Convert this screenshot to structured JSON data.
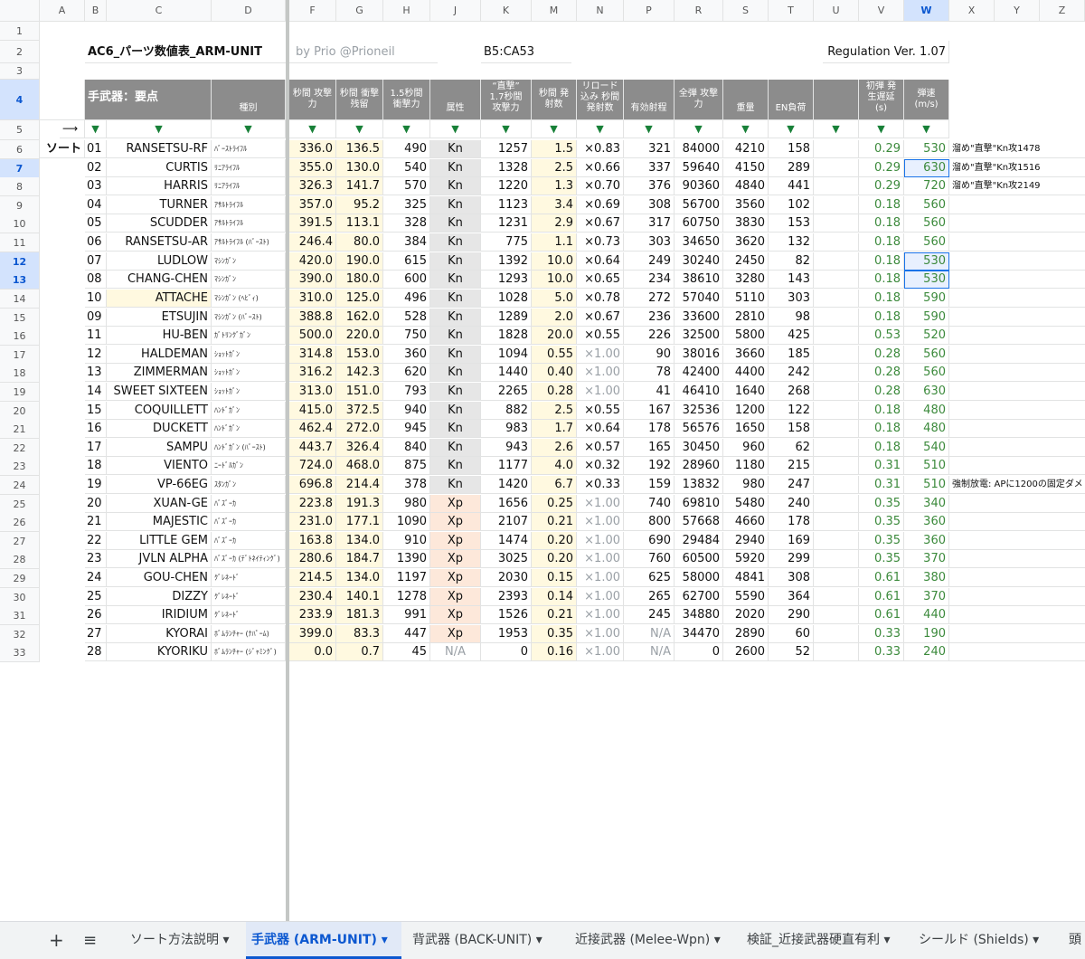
{
  "column_letters": [
    "A",
    "B",
    "C",
    "D",
    "F",
    "G",
    "H",
    "J",
    "K",
    "M",
    "N",
    "P",
    "R",
    "S",
    "T",
    "U",
    "V",
    "W",
    "X",
    "Y",
    "Z"
  ],
  "row2": {
    "title": "AC6_パーツ数値表_ARM-UNIT",
    "byline": "by Prio @Prioneil",
    "range": "B5:CA53",
    "regulation": "Regulation Ver. 1.07"
  },
  "row4": {
    "label": "手武器：要点",
    "type": "種別",
    "h_f": "秒間 攻撃力",
    "h_g": "秒間 衝撃残留",
    "h_h": "1.5秒間 衝撃力",
    "h_j": "属性",
    "h_k": "“直撃” 1.7秒間 攻撃力",
    "h_m": "秒間 発射数",
    "h_n": "リロード込み 秒間 発射数",
    "h_p": "有効射程",
    "h_r": "全弾 攻撃力",
    "h_s": "重量",
    "h_t": "EN負荷",
    "h_v": "初弾 発生遅延 (s)",
    "h_w": "弾速 (m/s)"
  },
  "row5": {
    "arrow": "⟶",
    "sort": "ソート"
  },
  "rows": [
    [
      "6",
      "01",
      "RANSETSU-RF",
      "ﾊﾞｰｽﾄﾗｲﾌﾙ",
      "336.0",
      "136.5",
      "490",
      "Kn",
      "1257",
      "1.5",
      "×0.83",
      "321",
      "84000",
      "4210",
      "158",
      "0.29",
      "530",
      "溜め\"直撃\"Kn攻1478"
    ],
    [
      "7",
      "02",
      "CURTIS",
      "ﾘﾆｱﾗｲﾌﾙ",
      "355.0",
      "130.0",
      "540",
      "Kn",
      "1328",
      "2.5",
      "×0.66",
      "337",
      "59640",
      "4150",
      "289",
      "0.29",
      "630",
      "溜め\"直撃\"Kn攻1516"
    ],
    [
      "8",
      "03",
      "HARRIS",
      "ﾘﾆｱﾗｲﾌﾙ",
      "326.3",
      "141.7",
      "570",
      "Kn",
      "1220",
      "1.3",
      "×0.70",
      "376",
      "90360",
      "4840",
      "441",
      "0.29",
      "720",
      "溜め\"直撃\"Kn攻2149"
    ],
    [
      "9",
      "04",
      "TURNER",
      "ｱｻﾙﾄﾗｲﾌﾙ",
      "357.0",
      "95.2",
      "325",
      "Kn",
      "1123",
      "3.4",
      "×0.69",
      "308",
      "56700",
      "3560",
      "102",
      "0.18",
      "560",
      ""
    ],
    [
      "10",
      "05",
      "SCUDDER",
      "ｱｻﾙﾄﾗｲﾌﾙ",
      "391.5",
      "113.1",
      "328",
      "Kn",
      "1231",
      "2.9",
      "×0.67",
      "317",
      "60750",
      "3830",
      "153",
      "0.18",
      "560",
      ""
    ],
    [
      "11",
      "06",
      "RANSETSU-AR",
      "ｱｻﾙﾄﾗｲﾌﾙ (ﾊﾞｰｽﾄ)",
      "246.4",
      "80.0",
      "384",
      "Kn",
      "775",
      "1.1",
      "×0.73",
      "303",
      "34650",
      "3620",
      "132",
      "0.18",
      "560",
      ""
    ],
    [
      "12",
      "07",
      "LUDLOW",
      "ﾏｼﾝｶﾞﾝ",
      "420.0",
      "190.0",
      "615",
      "Kn",
      "1392",
      "10.0",
      "×0.64",
      "249",
      "30240",
      "2450",
      "82",
      "0.18",
      "530",
      ""
    ],
    [
      "13",
      "08",
      "CHANG-CHEN",
      "ﾏｼﾝｶﾞﾝ",
      "390.0",
      "180.0",
      "600",
      "Kn",
      "1293",
      "10.0",
      "×0.65",
      "234",
      "38610",
      "3280",
      "143",
      "0.18",
      "530",
      ""
    ],
    [
      "14",
      "10",
      "ATTACHE",
      "ﾏｼﾝｶﾞﾝ (ﾍﾋﾞｨ)",
      "310.0",
      "125.0",
      "496",
      "Kn",
      "1028",
      "5.0",
      "×0.78",
      "272",
      "57040",
      "5110",
      "303",
      "0.18",
      "590",
      ""
    ],
    [
      "15",
      "09",
      "ETSUJIN",
      "ﾏｼﾝｶﾞﾝ (ﾊﾞｰｽﾄ)",
      "388.8",
      "162.0",
      "528",
      "Kn",
      "1289",
      "2.0",
      "×0.67",
      "236",
      "33600",
      "2810",
      "98",
      "0.18",
      "590",
      ""
    ],
    [
      "16",
      "11",
      "HU-BEN",
      "ｶﾞﾄﾘﾝｸﾞｶﾞﾝ",
      "500.0",
      "220.0",
      "750",
      "Kn",
      "1828",
      "20.0",
      "×0.55",
      "226",
      "32500",
      "5800",
      "425",
      "0.53",
      "520",
      ""
    ],
    [
      "17",
      "12",
      "HALDEMAN",
      "ｼｮｯﾄｶﾞﾝ",
      "314.8",
      "153.0",
      "360",
      "Kn",
      "1094",
      "0.55",
      "×1.00",
      "90",
      "38016",
      "3660",
      "185",
      "0.28",
      "560",
      ""
    ],
    [
      "18",
      "13",
      "ZIMMERMAN",
      "ｼｮｯﾄｶﾞﾝ",
      "316.2",
      "142.3",
      "620",
      "Kn",
      "1440",
      "0.40",
      "×1.00",
      "78",
      "42400",
      "4400",
      "242",
      "0.28",
      "560",
      ""
    ],
    [
      "19",
      "14",
      "SWEET SIXTEEN",
      "ｼｮｯﾄｶﾞﾝ",
      "313.0",
      "151.0",
      "793",
      "Kn",
      "2265",
      "0.28",
      "×1.00",
      "41",
      "46410",
      "1640",
      "268",
      "0.28",
      "630",
      ""
    ],
    [
      "20",
      "15",
      "COQUILLETT",
      "ﾊﾝﾄﾞｶﾞﾝ",
      "415.0",
      "372.5",
      "940",
      "Kn",
      "882",
      "2.5",
      "×0.55",
      "167",
      "32536",
      "1200",
      "122",
      "0.18",
      "480",
      ""
    ],
    [
      "21",
      "16",
      "DUCKETT",
      "ﾊﾝﾄﾞｶﾞﾝ",
      "462.4",
      "272.0",
      "945",
      "Kn",
      "983",
      "1.7",
      "×0.64",
      "178",
      "56576",
      "1650",
      "158",
      "0.18",
      "480",
      ""
    ],
    [
      "22",
      "17",
      "SAMPU",
      "ﾊﾝﾄﾞｶﾞﾝ (ﾊﾞｰｽﾄ)",
      "443.7",
      "326.4",
      "840",
      "Kn",
      "943",
      "2.6",
      "×0.57",
      "165",
      "30450",
      "960",
      "62",
      "0.18",
      "540",
      ""
    ],
    [
      "23",
      "18",
      "VIENTO",
      "ﾆｰﾄﾞﾙｶﾞﾝ",
      "724.0",
      "468.0",
      "875",
      "Kn",
      "1177",
      "4.0",
      "×0.32",
      "192",
      "28960",
      "1180",
      "215",
      "0.31",
      "510",
      ""
    ],
    [
      "24",
      "19",
      "VP-66EG",
      "ｽﾀﾝｶﾞﾝ",
      "696.8",
      "214.4",
      "378",
      "Kn",
      "1420",
      "6.7",
      "×0.33",
      "159",
      "13832",
      "980",
      "247",
      "0.31",
      "510",
      "強制放電: APに1200の固定ダメ"
    ],
    [
      "25",
      "20",
      "XUAN-GE",
      "ﾊﾞｽﾞｰｶ",
      "223.8",
      "191.3",
      "980",
      "Xp",
      "1656",
      "0.25",
      "×1.00",
      "740",
      "69810",
      "5480",
      "240",
      "0.35",
      "340",
      ""
    ],
    [
      "26",
      "21",
      "MAJESTIC",
      "ﾊﾞｽﾞｰｶ",
      "231.0",
      "177.1",
      "1090",
      "Xp",
      "2107",
      "0.21",
      "×1.00",
      "800",
      "57668",
      "4660",
      "178",
      "0.35",
      "360",
      ""
    ],
    [
      "27",
      "22",
      "LITTLE GEM",
      "ﾊﾞｽﾞｰｶ",
      "163.8",
      "134.0",
      "910",
      "Xp",
      "1474",
      "0.20",
      "×1.00",
      "690",
      "29484",
      "2940",
      "169",
      "0.35",
      "360",
      ""
    ],
    [
      "28",
      "23",
      "JVLN ALPHA",
      "ﾊﾞｽﾞｰｶ (ﾃﾞﾄﾈｲﾃｨﾝｸﾞ)",
      "280.6",
      "184.7",
      "1390",
      "Xp",
      "3025",
      "0.20",
      "×1.00",
      "760",
      "60500",
      "5920",
      "299",
      "0.35",
      "370",
      ""
    ],
    [
      "29",
      "24",
      "GOU-CHEN",
      "ｸﾞﾚﾈｰﾄﾞ",
      "214.5",
      "134.0",
      "1197",
      "Xp",
      "2030",
      "0.15",
      "×1.00",
      "625",
      "58000",
      "4841",
      "308",
      "0.61",
      "380",
      ""
    ],
    [
      "30",
      "25",
      "DIZZY",
      "ｸﾞﾚﾈｰﾄﾞ",
      "230.4",
      "140.1",
      "1278",
      "Xp",
      "2393",
      "0.14",
      "×1.00",
      "265",
      "62700",
      "5590",
      "364",
      "0.61",
      "370",
      ""
    ],
    [
      "31",
      "26",
      "IRIDIUM",
      "ｸﾞﾚﾈｰﾄﾞ",
      "233.9",
      "181.3",
      "991",
      "Xp",
      "1526",
      "0.21",
      "×1.00",
      "245",
      "34880",
      "2020",
      "290",
      "0.61",
      "440",
      ""
    ],
    [
      "32",
      "27",
      "KYORAI",
      "ﾎﾞﾑﾗﾝﾁｬｰ (ﾅﾊﾟｰﾑ)",
      "399.0",
      "83.3",
      "447",
      "Xp",
      "1953",
      "0.35",
      "×1.00",
      "N/A",
      "34470",
      "2890",
      "60",
      "0.33",
      "190",
      ""
    ],
    [
      "33",
      "28",
      "KYORIKU",
      "ﾎﾞﾑﾗﾝﾁｬｰ (ｼﾞｬﾐﾝｸﾞ)",
      "0.0",
      "0.7",
      "45",
      "N/A",
      "0",
      "0.16",
      "×1.00",
      "N/A",
      "0",
      "2600",
      "52",
      "0.33",
      "240",
      ""
    ]
  ],
  "tabs": {
    "add": "+",
    "menu": "≡",
    "t1": "ソート方法説明",
    "t2": "手武器 (ARM-UNIT)",
    "t3": "背武器 (BACK-UNIT)",
    "t4": "近接武器 (Melee-Wpn)",
    "t5": "検証_近接武器硬直有利",
    "t6": "シールド (Shields)",
    "t7": "頭"
  }
}
